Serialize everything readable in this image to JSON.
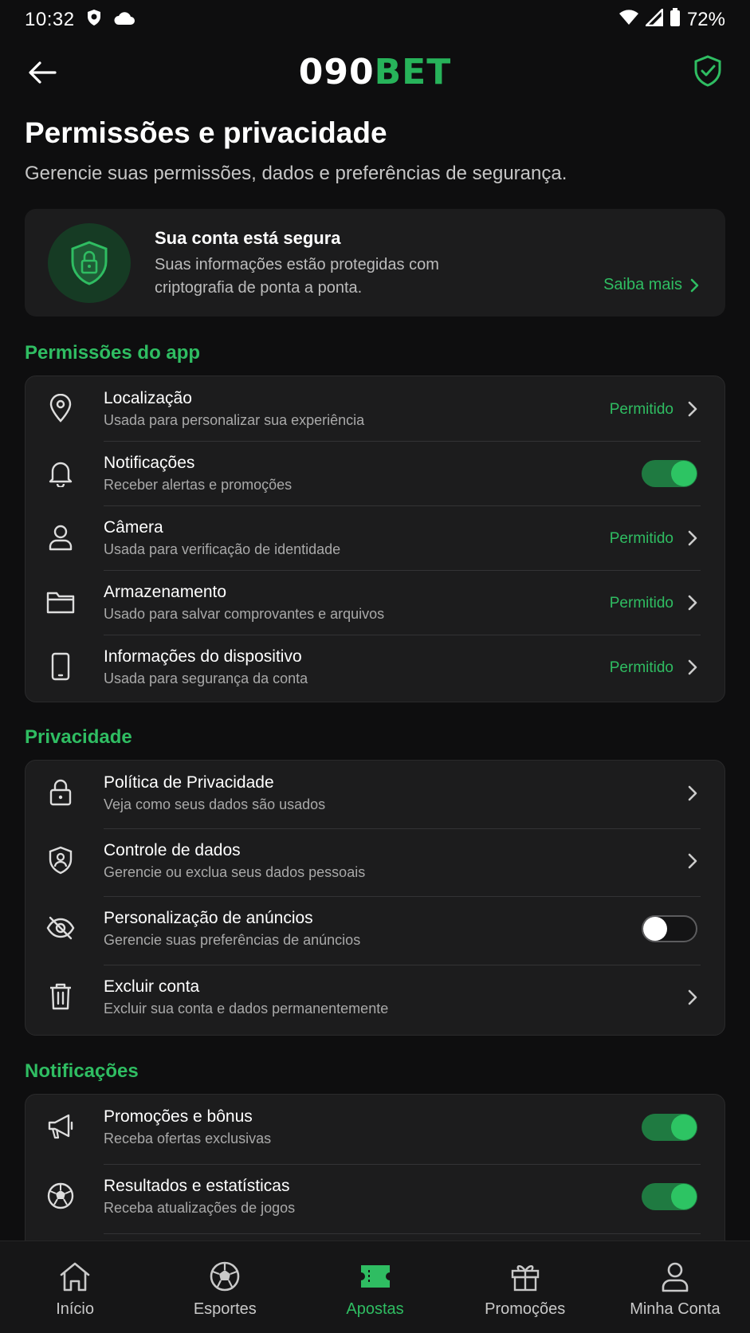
{
  "status_bar": {
    "time": "10:32",
    "battery": "72%"
  },
  "header": {
    "logo_part1": "090",
    "logo_part2": "BET"
  },
  "page": {
    "title": "Permissões e privacidade",
    "subtitle": "Gerencie suas permissões, dados e preferências de segurança."
  },
  "secure_card": {
    "title": "Sua conta está segura",
    "text": "Suas informações estão protegidas com criptografia de ponta a ponta.",
    "link": "Saiba mais"
  },
  "sections": {
    "app_permissions": "Permissões do app",
    "privacy": "Privacidade",
    "notifications": "Notificações"
  },
  "app_permissions": [
    {
      "label": "Localização",
      "sub": "Usada para personalizar sua experiência",
      "status": "Permitido"
    },
    {
      "label": "Notificações",
      "sub": "Receber alertas e promoções",
      "toggle": true
    },
    {
      "label": "Câmera",
      "sub": "Usada para verificação de identidade",
      "status": "Permitido"
    },
    {
      "label": "Armazenamento",
      "sub": "Usado para salvar comprovantes e arquivos",
      "status": "Permitido"
    },
    {
      "label": "Informações do dispositivo",
      "sub": "Usada para segurança da conta",
      "status": "Permitido"
    }
  ],
  "privacy": [
    {
      "label": "Política de Privacidade",
      "sub": "Veja como seus dados são usados"
    },
    {
      "label": "Controle de dados",
      "sub": "Gerencie ou exclua seus dados pessoais"
    },
    {
      "label": "Personalização de anúncios",
      "sub": "Gerencie suas preferências de anúncios",
      "toggle": false
    },
    {
      "label": "Excluir conta",
      "sub": "Excluir sua conta e dados permanentemente"
    }
  ],
  "notifications": [
    {
      "label": "Promoções e bônus",
      "sub": "Receba ofertas exclusivas",
      "toggle": true
    },
    {
      "label": "Resultados e estatísticas",
      "sub": "Receba atualizações de jogos",
      "toggle": true
    }
  ],
  "bottom_nav": [
    {
      "label": "Início",
      "icon": "home-icon"
    },
    {
      "label": "Esportes",
      "icon": "soccer-ball-icon"
    },
    {
      "label": "Apostas",
      "icon": "ticket-icon",
      "active": true
    },
    {
      "label": "Promoções",
      "icon": "gift-icon"
    },
    {
      "label": "Minha Conta",
      "icon": "user-icon"
    }
  ],
  "colors": {
    "accent": "#2fbd62",
    "background": "#0e0e0f",
    "card": "#1c1c1d"
  }
}
